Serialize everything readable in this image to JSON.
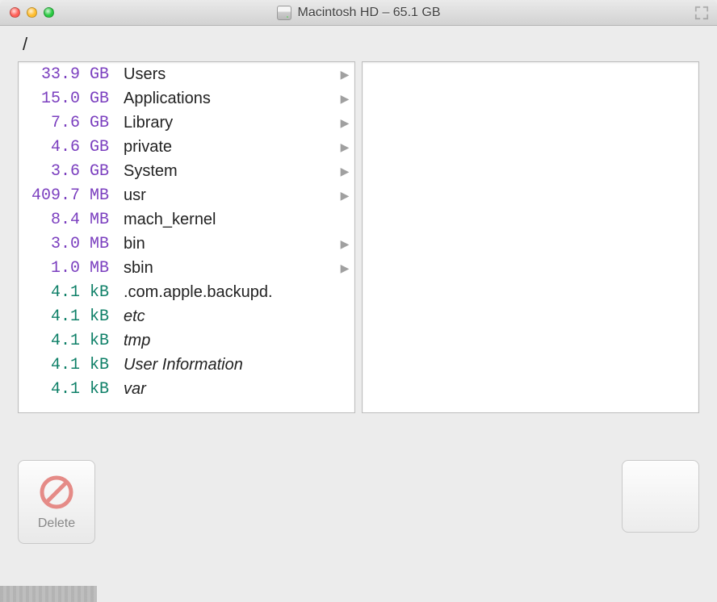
{
  "window": {
    "title": "Macintosh HD – 65.1 GB"
  },
  "path": "/",
  "buttons": {
    "delete_label": "Delete"
  },
  "items": [
    {
      "size_num": "33.9",
      "size_unit": "GB",
      "color": "purple",
      "name": "Users",
      "italic": false,
      "has_children": true
    },
    {
      "size_num": "15.0",
      "size_unit": "GB",
      "color": "purple",
      "name": "Applications",
      "italic": false,
      "has_children": true
    },
    {
      "size_num": "7.6",
      "size_unit": "GB",
      "color": "purple",
      "name": "Library",
      "italic": false,
      "has_children": true
    },
    {
      "size_num": "4.6",
      "size_unit": "GB",
      "color": "purple",
      "name": "private",
      "italic": false,
      "has_children": true
    },
    {
      "size_num": "3.6",
      "size_unit": "GB",
      "color": "purple",
      "name": "System",
      "italic": false,
      "has_children": true
    },
    {
      "size_num": "409.7",
      "size_unit": "MB",
      "color": "purple",
      "name": "usr",
      "italic": false,
      "has_children": true
    },
    {
      "size_num": "8.4",
      "size_unit": "MB",
      "color": "purple",
      "name": "mach_kernel",
      "italic": false,
      "has_children": false
    },
    {
      "size_num": "3.0",
      "size_unit": "MB",
      "color": "purple",
      "name": "bin",
      "italic": false,
      "has_children": true
    },
    {
      "size_num": "1.0",
      "size_unit": "MB",
      "color": "purple",
      "name": "sbin",
      "italic": false,
      "has_children": true
    },
    {
      "size_num": "4.1",
      "size_unit": "kB",
      "color": "teal",
      "name": ".com.apple.backupd.",
      "italic": false,
      "has_children": false
    },
    {
      "size_num": "4.1",
      "size_unit": "kB",
      "color": "teal",
      "name": "etc",
      "italic": true,
      "has_children": false
    },
    {
      "size_num": "4.1",
      "size_unit": "kB",
      "color": "teal",
      "name": "tmp",
      "italic": true,
      "has_children": false
    },
    {
      "size_num": "4.1",
      "size_unit": "kB",
      "color": "teal",
      "name": "User Information",
      "italic": true,
      "has_children": false
    },
    {
      "size_num": "4.1",
      "size_unit": "kB",
      "color": "teal",
      "name": "var",
      "italic": true,
      "has_children": false
    }
  ]
}
